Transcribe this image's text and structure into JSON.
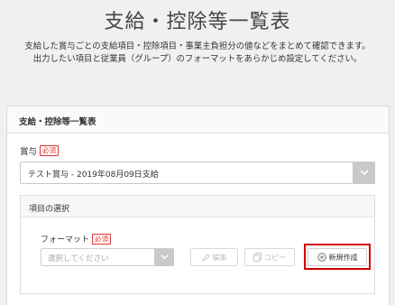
{
  "page": {
    "title": "支給・控除等一覧表",
    "description_line1": "支給した賞与ごとの支給項目・控除項目・事業主負担分の値などをまとめて確認できます。",
    "description_line2": "出力したい項目と従業員（グループ）のフォーマットをあらかじめ設定してください。"
  },
  "panel": {
    "header": "支給・控除等一覧表",
    "bonus_label": "賞与",
    "required_badge": "必須",
    "bonus_selected": "テスト賞与 - 2019年08月09日支給"
  },
  "items_section": {
    "header": "項目の選択",
    "format_label": "フォーマット",
    "required_badge": "必須",
    "format_placeholder": "選択してください",
    "edit_label": "編集",
    "copy_label": "コピー",
    "new_label": "新規作成"
  },
  "colors": {
    "required": "#d33333",
    "highlight": "#d40000",
    "arrow_bg": "#c9c9c9"
  },
  "icons": {
    "edit": "pencil-icon",
    "copy": "copy-icon",
    "new": "plus-circle-icon",
    "dropdown": "chevron-down-icon"
  }
}
